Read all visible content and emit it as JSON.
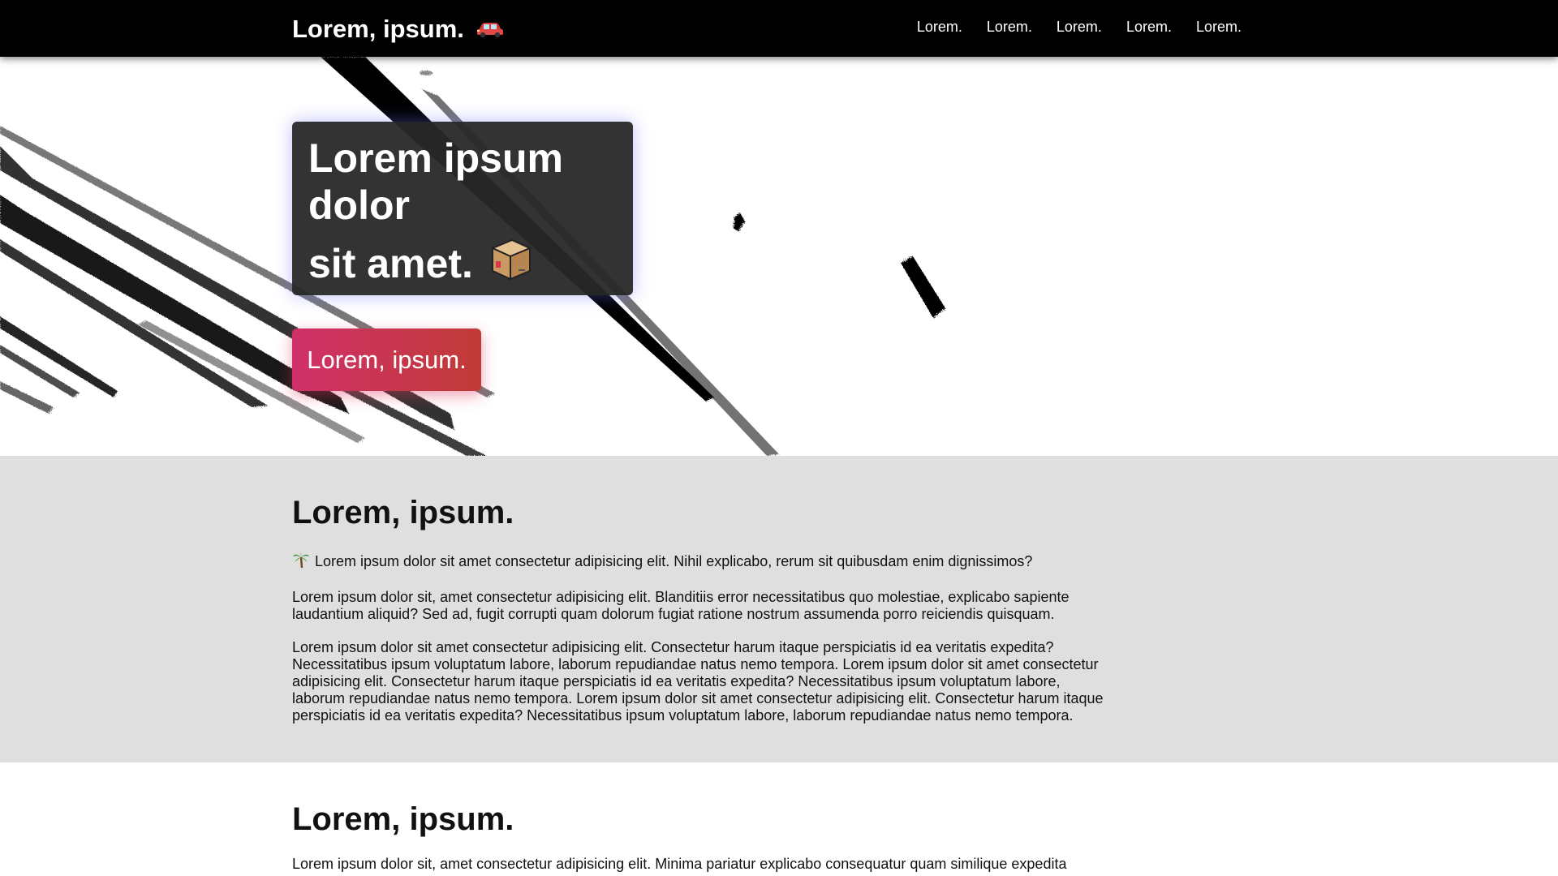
{
  "navbar": {
    "brand_label": "Lorem, ipsum.",
    "brand_emoji": "car-icon",
    "links": [
      "Lorem.",
      "Lorem.",
      "Lorem.",
      "Lorem.",
      "Lorem."
    ]
  },
  "hero": {
    "heading_line1": "Lorem ipsum",
    "heading_line2": "dolor",
    "heading_line3": "sit amet.",
    "heading_emoji": "package-icon",
    "cta_label": "Lorem, ipsum."
  },
  "section1": {
    "title": "Lorem, ipsum.",
    "intro_icon": "palm-tree-icon",
    "intro": "Lorem ipsum dolor sit amet consectetur adipisicing elit. Nihil explicabo, rerum sit quibusdam enim dignissimos?",
    "paragraph2": "Lorem ipsum dolor sit, amet consectetur adipisicing elit. Blanditiis error necessitatibus quo molestiae, explicabo sapiente laudantium aliquid? Sed ad, fugit corrupti quam dolorum fugiat ratione nostrum assumenda porro reiciendis quisquam.",
    "paragraph3": "Lorem ipsum dolor sit amet consectetur adipisicing elit. Consectetur harum itaque perspiciatis id ea veritatis expedita? Necessitatibus ipsum voluptatum labore, laborum repudiandae natus nemo tempora. Lorem ipsum dolor sit amet consectetur adipisicing elit. Consectetur harum itaque perspiciatis id ea veritatis expedita? Necessitatibus ipsum voluptatum labore, laborum repudiandae natus nemo tempora. Lorem ipsum dolor sit amet consectetur adipisicing elit. Consectetur harum itaque perspiciatis id ea veritatis expedita? Necessitatibus ipsum voluptatum labore, laborum repudiandae natus nemo tempora."
  },
  "section2": {
    "title": "Lorem, ipsum.",
    "paragraph1": "Lorem ipsum dolor sit, amet consectetur adipisicing elit. Minima pariatur explicabo consequatur quam similique expedita"
  },
  "colors": {
    "navbar_bg": "#000000",
    "section_gray_bg": "#e0dfe0",
    "cta_gradient_start": "#d0306a",
    "cta_gradient_end": "#c13b36",
    "hero_box_bg": "#282828"
  }
}
